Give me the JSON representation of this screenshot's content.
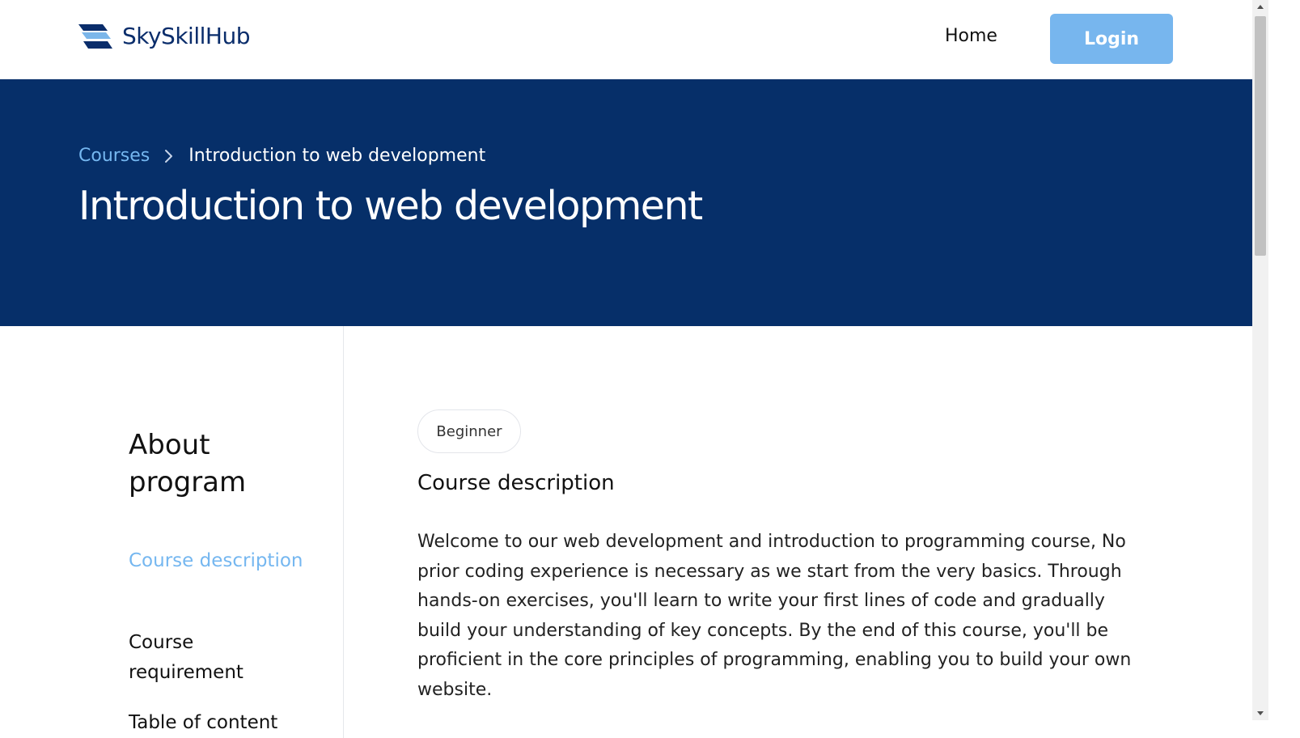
{
  "header": {
    "brand_name": "SkySkillHub",
    "brand_logo_icon": "stacked-chevrons-logo",
    "nav_home": "Home",
    "login_label": "Login"
  },
  "hero": {
    "breadcrumb": {
      "parent": "Courses",
      "separator_icon": "chevron-right-icon",
      "current": "Introduction to web development"
    },
    "title": "Introduction to web development"
  },
  "sidebar": {
    "title": "About program",
    "links": [
      {
        "label": "Course description",
        "active": true
      },
      {
        "label": "Course requirement",
        "active": false
      },
      {
        "label": "Table of content",
        "active": false
      }
    ]
  },
  "main": {
    "level_badge": "Beginner",
    "section_heading": "Course description",
    "section_text": "Welcome to our web development and introduction to programming course, No prior coding experience is necessary as we start from the very basics. Through hands-on exercises, you'll learn to write your first lines of code and gradually build your understanding of key concepts. By the end of this course, you'll be proficient in the core principles of programming, enabling you to build your own website."
  },
  "colors": {
    "navy": "#062f69",
    "accent_light_blue": "#75b7f0",
    "login_button": "#77b6ee",
    "brand_text": "#0a2d6b"
  }
}
